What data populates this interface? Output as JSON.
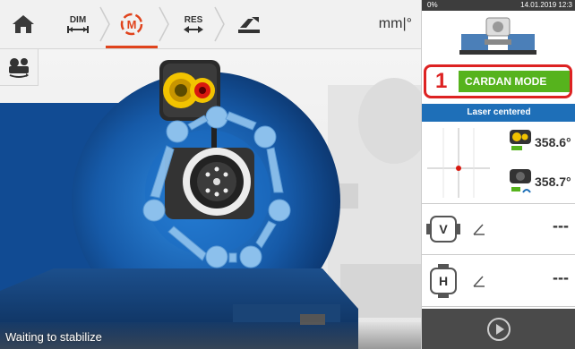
{
  "toolbar": {
    "items": [
      {
        "label": "",
        "icon": "home-icon"
      },
      {
        "label": "DIM",
        "icon": "dimensions-icon"
      },
      {
        "label": "",
        "icon": "measure-mode-icon"
      },
      {
        "label": "RES",
        "icon": "results-icon"
      },
      {
        "label": "",
        "icon": "move-icon"
      }
    ],
    "units": "mm|°"
  },
  "scene": {
    "status_text": "Waiting to stabilize"
  },
  "status_bar": {
    "battery": "0%",
    "datetime": "14.01.2019 12:3"
  },
  "panel": {
    "mode_number": "1",
    "mode_label": "CARDAN MODE",
    "laser_status": "Laser centered",
    "sensor_reading": "358.6°",
    "laser_reading": "358.7°",
    "vertical_label": "V",
    "horizontal_label": "H",
    "vertical_value": "---",
    "horizontal_value": "---"
  },
  "colors": {
    "accent_green": "#56b31d",
    "highlight_red": "#d22",
    "banner_blue": "#1e6fb8",
    "active_orange": "#e0431c"
  }
}
